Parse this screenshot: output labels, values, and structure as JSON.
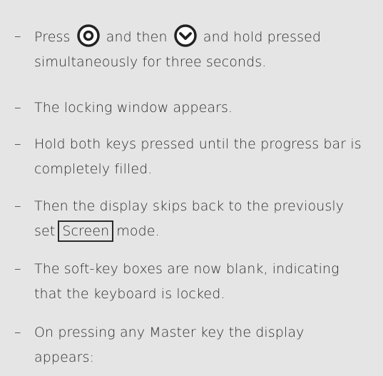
{
  "steps": [
    {
      "part1": "Press",
      "part2": "and then",
      "part3": "and hold pressed",
      "line2": "simultaneously for three seconds.",
      "icon1": "circle-ok-key-icon",
      "icon2": "circle-down-key-icon"
    },
    {
      "text": "The locking window appears."
    },
    {
      "line1": "Hold both keys pressed until the progress bar is",
      "line2": "completely filled."
    },
    {
      "line1": "Then the display skips back to the previously",
      "prefix": "set",
      "boxed": "Screen",
      "suffix": "mode."
    },
    {
      "line1": "The soft-key boxes are now blank, indicating",
      "line2": "that the keyboard is locked."
    },
    {
      "line1": "On pressing any Master key the display",
      "line2": "appears:"
    }
  ],
  "dash": "–"
}
